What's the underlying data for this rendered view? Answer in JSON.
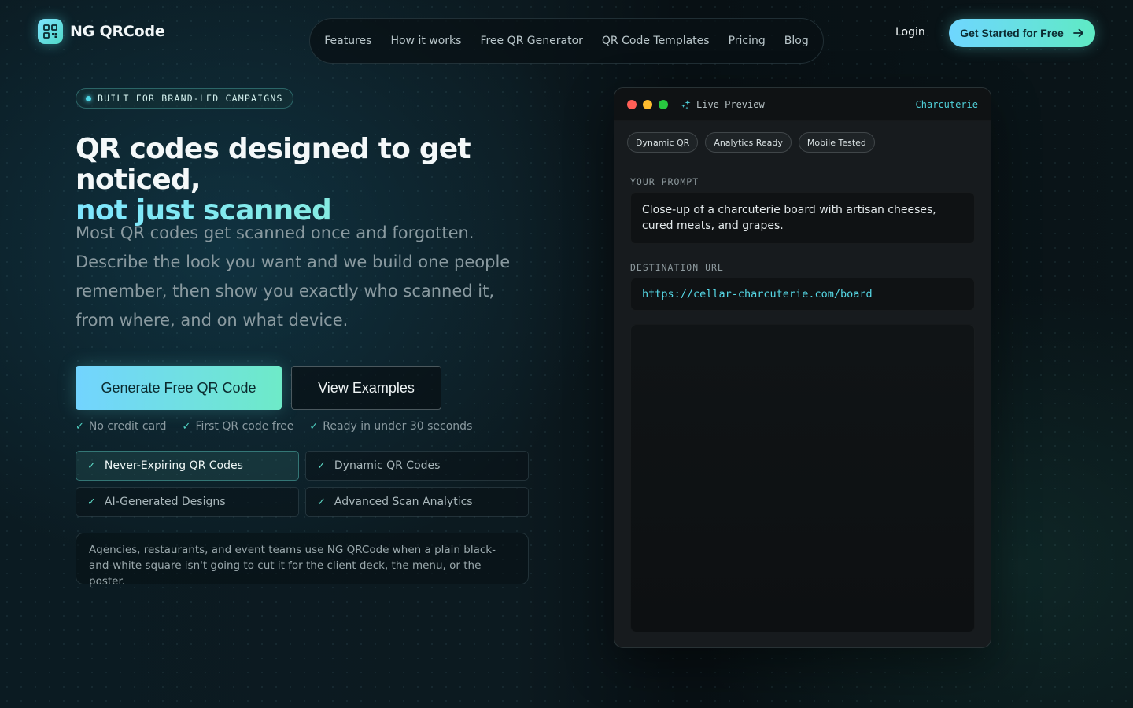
{
  "brand": {
    "name": "NG QRCode",
    "logo_icon": "qr-code-icon"
  },
  "nav": {
    "items": [
      "Features",
      "How it works",
      "Free QR Generator",
      "QR Code Templates",
      "Pricing",
      "Blog"
    ]
  },
  "header": {
    "login": "Login",
    "cta": "Get Started for Free",
    "cta_icon": "arrow-right-icon"
  },
  "hero": {
    "badge": "BUILT FOR BRAND-LED CAMPAIGNS",
    "title_line1": "QR codes designed to get noticed,",
    "title_line2": "not just scanned",
    "lead": "Most QR codes get scanned once and forgotten. Describe the look you want and we build one people remember, then show you exactly who scanned it, from where, and on what device.",
    "primary_cta": "Generate Free QR Code",
    "secondary_cta": "View Examples",
    "checks": [
      "No credit card",
      "First QR code free",
      "Ready in under 30 seconds"
    ],
    "features": [
      {
        "label": "Never-Expiring QR Codes",
        "active": true
      },
      {
        "label": "Dynamic QR Codes",
        "active": false
      },
      {
        "label": "AI-Generated Designs",
        "active": false
      },
      {
        "label": "Advanced Scan Analytics",
        "active": false
      }
    ],
    "note": "Agencies, restaurants, and event teams use NG QRCode when a plain black-and-white square isn't going to cut it for the client deck, the menu, or the poster."
  },
  "preview": {
    "title": "Live Preview",
    "title_icon": "sparkle-icon",
    "tag": "Charcuterie",
    "pills": [
      "Dynamic QR",
      "Analytics Ready",
      "Mobile Tested"
    ],
    "prompt_label": "YOUR PROMPT",
    "prompt_text": "Close-up of a charcuterie board with artisan cheeses, cured meats, and grapes.",
    "url_label": "DESTINATION URL",
    "url_value": "https://cellar-charcuterie.com/board"
  },
  "colors": {
    "accent_cyan": "#72d4ff",
    "accent_mint": "#6eeac8",
    "window_red": "#ff5f57",
    "window_yellow": "#febc2e",
    "window_green": "#28c840"
  }
}
